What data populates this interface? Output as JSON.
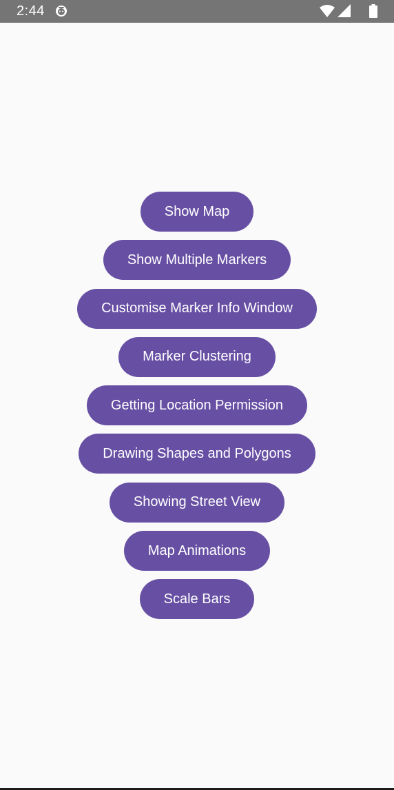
{
  "status_bar": {
    "time": "2:44",
    "icons": [
      "app-notification-icon",
      "wifi-icon",
      "signal-icon",
      "battery-icon"
    ]
  },
  "colors": {
    "button_background": "#6750a4",
    "button_text": "#ffffff",
    "page_background": "#fafafa",
    "status_bar": "#757575"
  },
  "buttons": [
    {
      "label": "Show Map"
    },
    {
      "label": "Show Multiple Markers"
    },
    {
      "label": "Customise Marker Info Window"
    },
    {
      "label": "Marker Clustering"
    },
    {
      "label": "Getting Location Permission"
    },
    {
      "label": "Drawing Shapes and Polygons"
    },
    {
      "label": "Showing Street View"
    },
    {
      "label": "Map Animations"
    },
    {
      "label": "Scale Bars"
    }
  ]
}
